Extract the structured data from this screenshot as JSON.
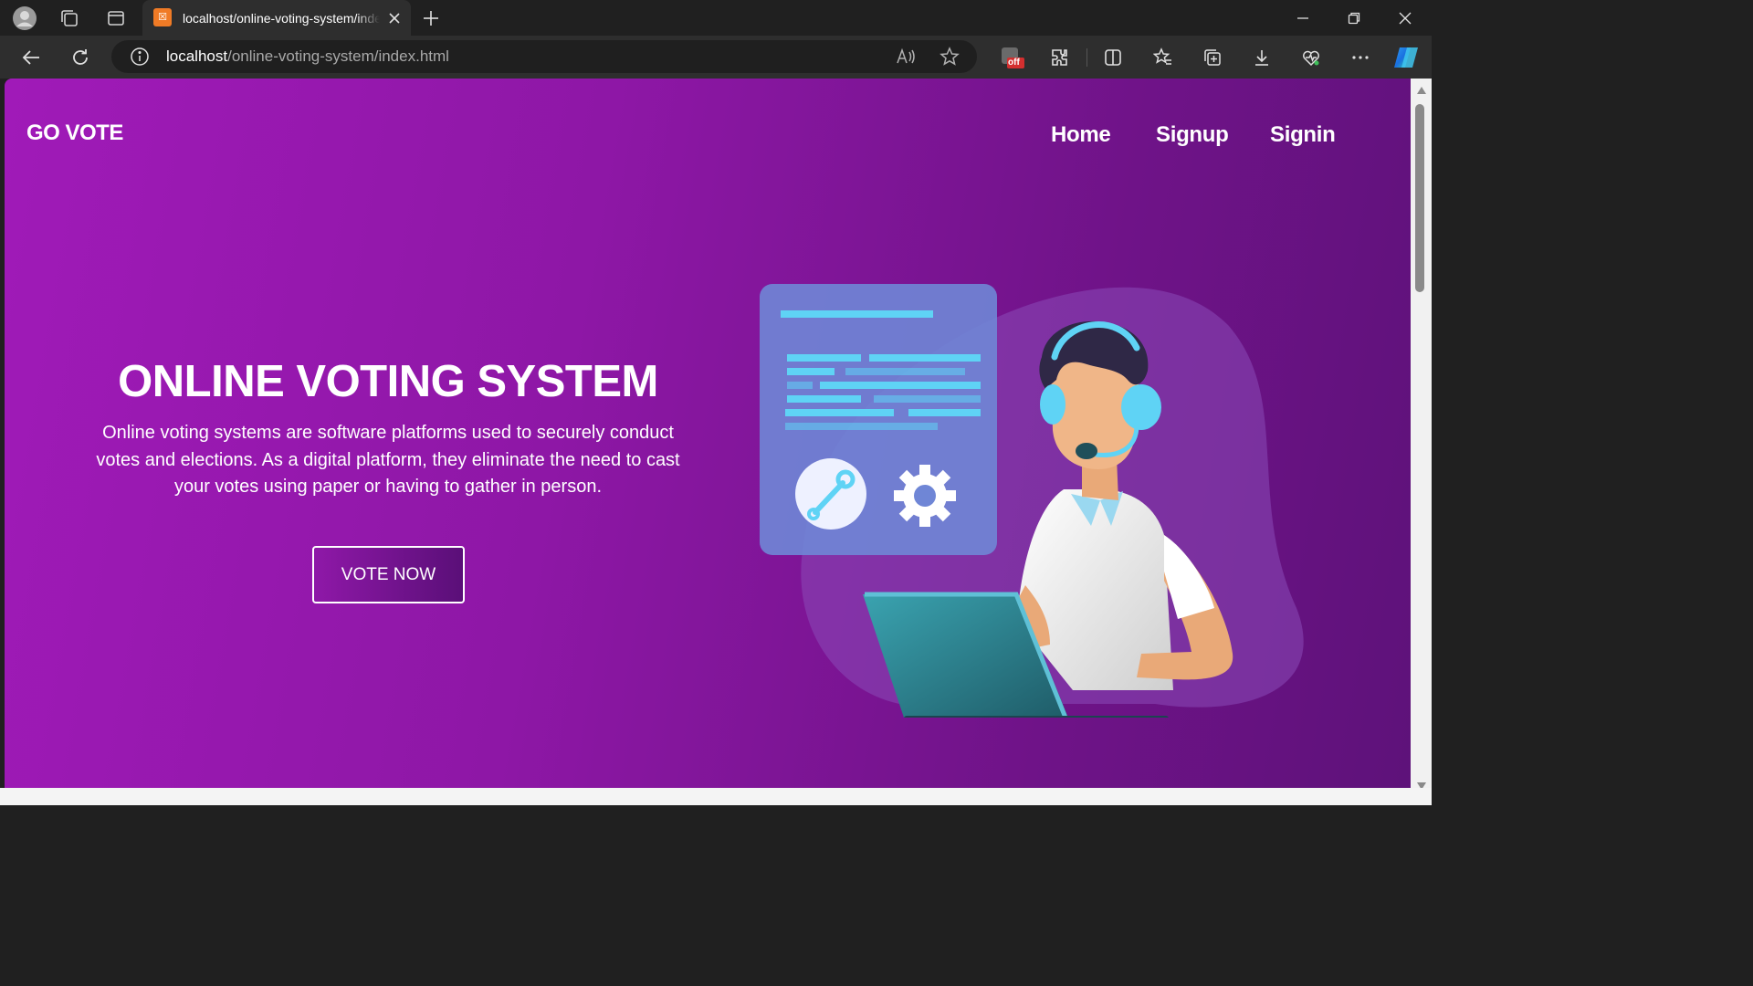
{
  "browser": {
    "tab": {
      "title": "localhost/online-voting-system/index.html"
    },
    "address": {
      "host": "localhost",
      "path": "/online-voting-system/index.html"
    },
    "extension_badge": "off"
  },
  "page": {
    "brand": "GO VOTE",
    "nav": {
      "home": "Home",
      "signup": "Signup",
      "signin": "Signin"
    },
    "hero": {
      "title": "ONLINE VOTING SYSTEM",
      "description": "Online voting systems are software platforms used to securely conduct votes and elections. As a digital platform, they eliminate the need to cast your votes using paper or having to gather in person.",
      "cta": "VOTE NOW"
    }
  },
  "colors": {
    "gradient_start": "#a01ab8",
    "gradient_end": "#5e127a",
    "accent_cyan": "#5fd3f5",
    "favicon": "#f07b26"
  }
}
